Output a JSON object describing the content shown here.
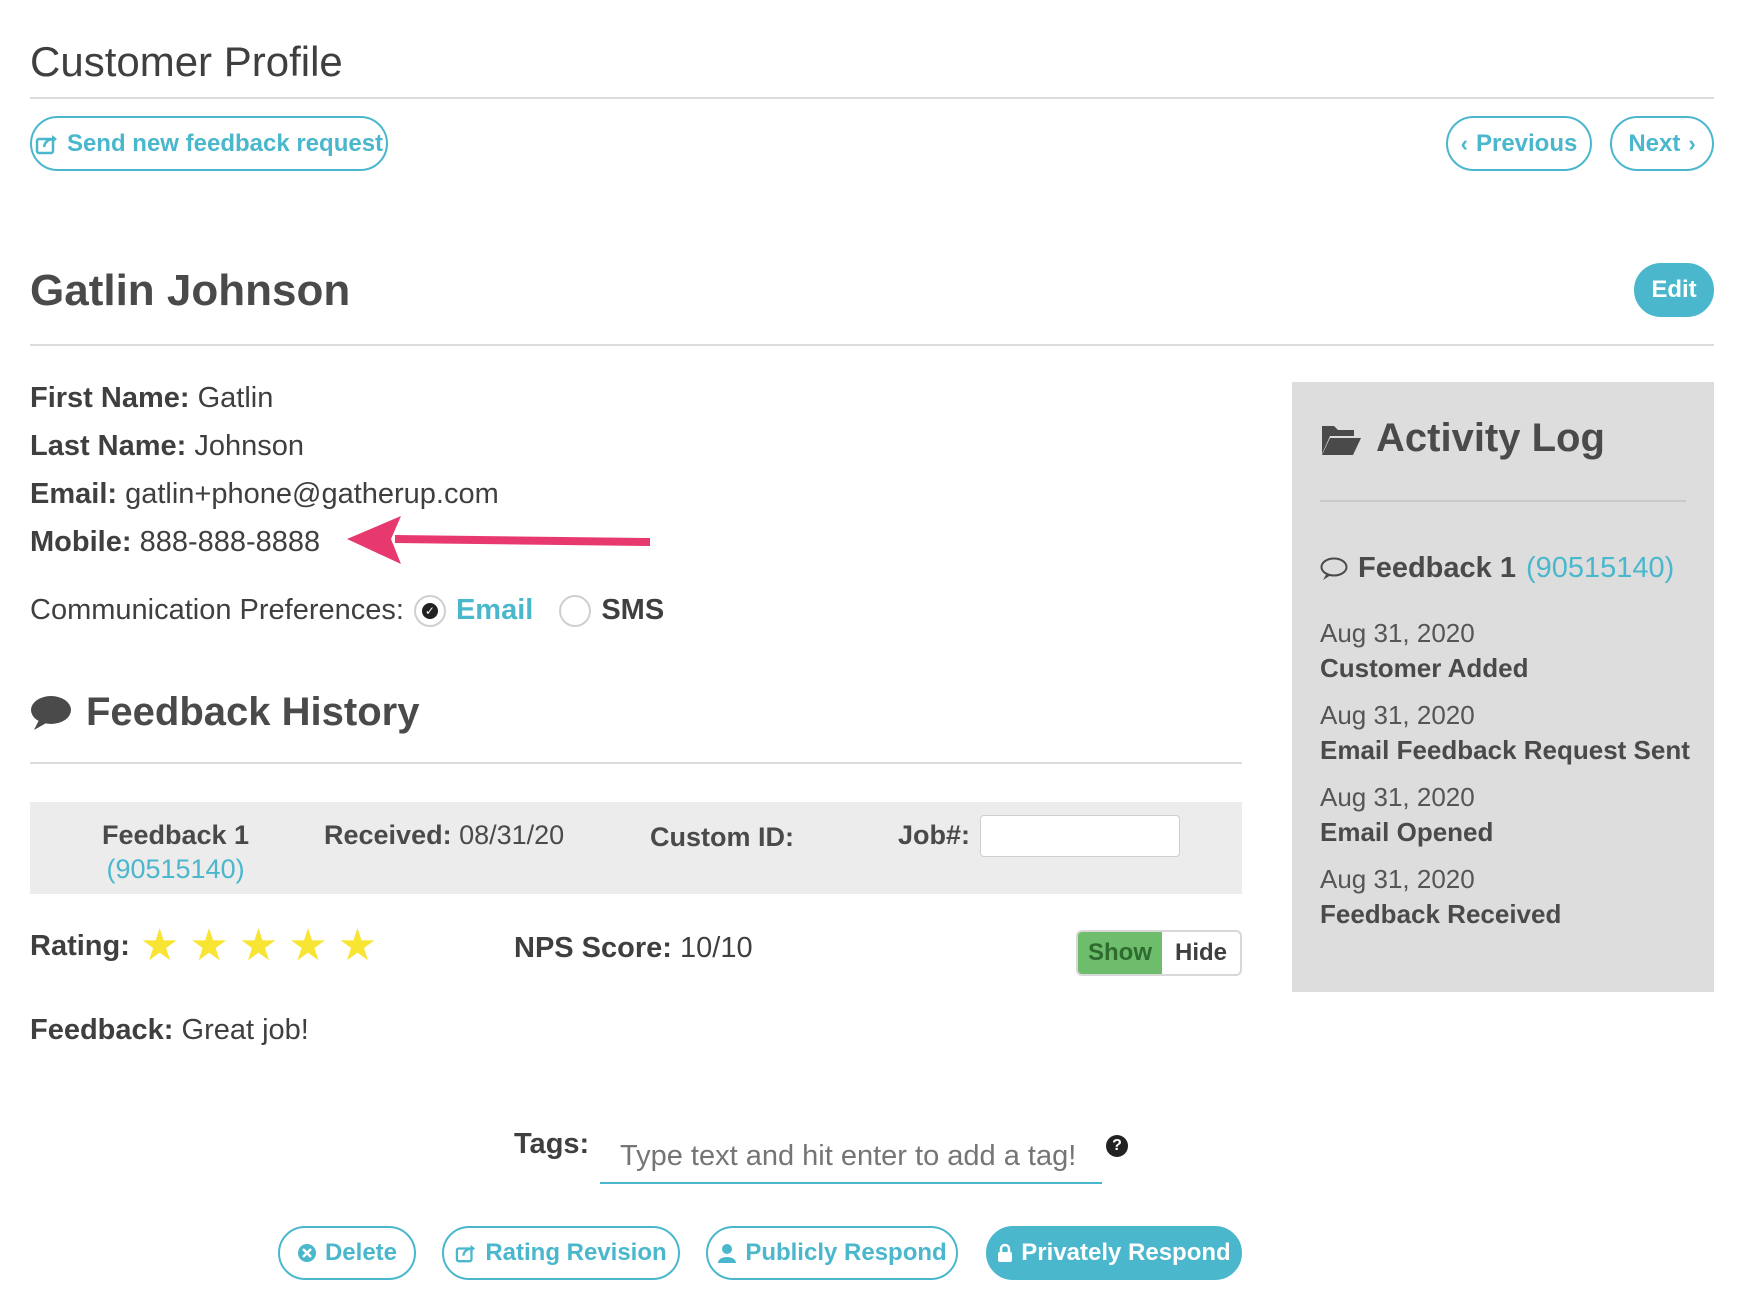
{
  "header": {
    "title": "Customer Profile",
    "send_request_label": "Send new feedback request",
    "previous_label": "Previous",
    "next_label": "Next"
  },
  "customer": {
    "name": "Gatlin Johnson",
    "edit_label": "Edit",
    "first_name_label": "First Name:",
    "first_name": "Gatlin",
    "last_name_label": "Last Name:",
    "last_name": "Johnson",
    "email_label": "Email:",
    "email": "gatlin+phone@gatherup.com",
    "mobile_label": "Mobile:",
    "mobile": "888-888-8888",
    "comm_pref_label": "Communication Preferences:",
    "comm_options": [
      {
        "label": "Email",
        "selected": true
      },
      {
        "label": "SMS",
        "selected": false
      }
    ]
  },
  "feedback_history": {
    "title": "Feedback History",
    "item": {
      "feedback_label": "Feedback 1",
      "feedback_id": "(90515140)",
      "received_label": "Received:",
      "received_value": "08/31/20",
      "custom_id_label": "Custom ID:",
      "job_label": "Job#:",
      "job_value": "",
      "rating_label": "Rating:",
      "rating": 5,
      "rating_max": 5,
      "nps_label": "NPS Score:",
      "nps_value": "10/10",
      "show_label": "Show",
      "hide_label": "Hide",
      "feedback_text_label": "Feedback:",
      "feedback_text": "Great job!",
      "tags_label": "Tags:",
      "tags_placeholder": "Type text and hit enter to add a tag!",
      "tags_help_icon": "question-circle-icon"
    },
    "actions": {
      "delete_label": "Delete",
      "rating_revision_label": "Rating Revision",
      "publicly_respond_label": "Publicly Respond",
      "privately_respond_label": "Privately Respond"
    }
  },
  "activity_log": {
    "title": "Activity Log",
    "feedback_label": "Feedback 1",
    "feedback_id": "(90515140)",
    "entries": [
      {
        "date": "Aug 31, 2020",
        "event": "Customer Added"
      },
      {
        "date": "Aug 31, 2020",
        "event": "Email Feedback Request Sent"
      },
      {
        "date": "Aug 31, 2020",
        "event": "Email Opened"
      },
      {
        "date": "Aug 31, 2020",
        "event": "Feedback Received"
      }
    ]
  },
  "colors": {
    "accent": "#4ab7cd",
    "star": "#f7e433",
    "arrow": "#e8396f",
    "show_toggle": "#6dbd6d",
    "panel_bg": "#dddddd"
  }
}
